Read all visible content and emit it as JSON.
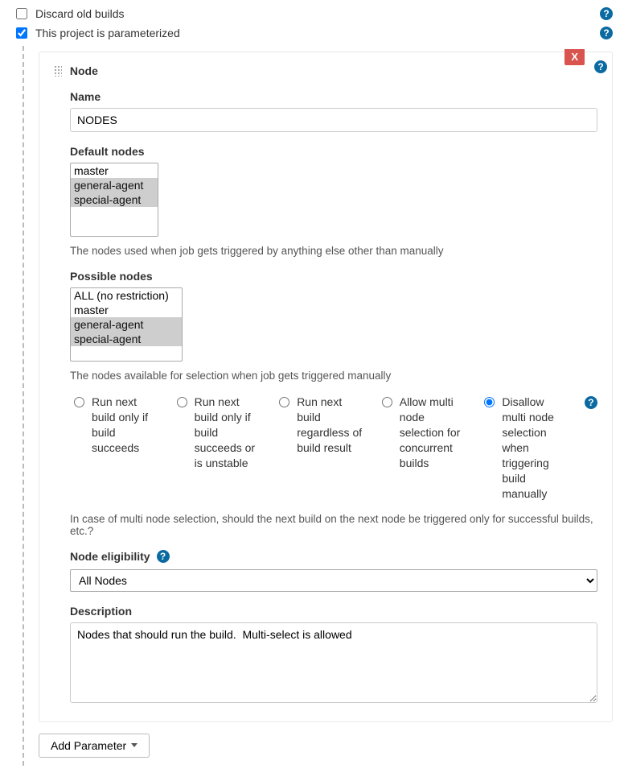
{
  "checkboxes": {
    "discard": {
      "label": "Discard old builds",
      "checked": false
    },
    "parameterized": {
      "label": "This project is parameterized",
      "checked": true
    }
  },
  "panel": {
    "title": "Node",
    "delete": "X"
  },
  "name": {
    "label": "Name",
    "value": "NODES"
  },
  "default_nodes": {
    "label": "Default nodes",
    "options": [
      "master",
      "general-agent",
      "special-agent"
    ],
    "selected": [
      "general-agent",
      "special-agent"
    ],
    "help": "The nodes used when job gets triggered by anything else other than manually"
  },
  "possible_nodes": {
    "label": "Possible nodes",
    "options": [
      "ALL (no restriction)",
      "master",
      "general-agent",
      "special-agent"
    ],
    "selected": [
      "general-agent",
      "special-agent"
    ],
    "help": "The nodes available for selection when job gets triggered manually"
  },
  "trigger_policy": {
    "options": [
      "Run next build only if build succeeds",
      "Run next build only if build succeeds or is unstable",
      "Run next build regardless of build result",
      "Allow multi node selection for concurrent builds",
      "Disallow multi node selection when triggering build manually"
    ],
    "selected_index": 4,
    "help": "In case of multi node selection, should the next build on the next node be triggered only for successful builds, etc.?"
  },
  "eligibility": {
    "label": "Node eligibility",
    "value": "All Nodes"
  },
  "description": {
    "label": "Description",
    "value": "Nodes that should run the build.  Multi-select is allowed"
  },
  "add_param": "Add Parameter"
}
